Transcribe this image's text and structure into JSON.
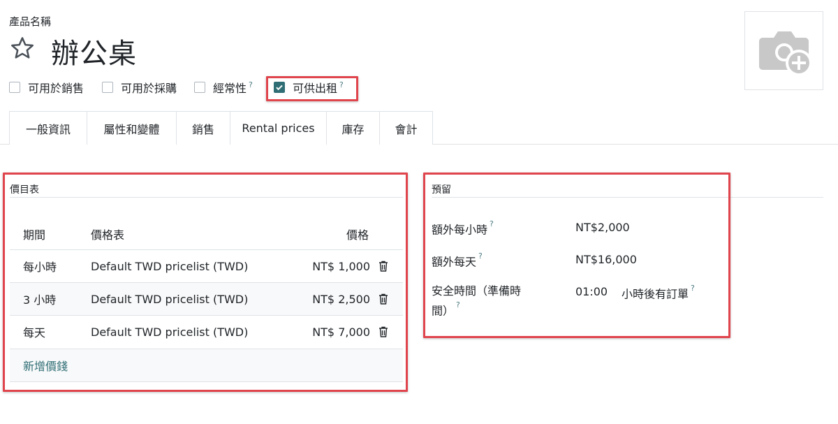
{
  "header": {
    "field_label": "產品名稱",
    "product_name": "辦公桌",
    "checkboxes": [
      {
        "label": "可用於銷售",
        "checked": false
      },
      {
        "label": "可用於採購",
        "checked": false
      },
      {
        "label": "經常性",
        "checked": false,
        "help": "?"
      },
      {
        "label": "可供出租",
        "checked": true,
        "help": "?"
      }
    ]
  },
  "tabs": [
    {
      "label": "一般資訊",
      "active": false
    },
    {
      "label": "屬性和變體",
      "active": false
    },
    {
      "label": "銷售",
      "active": false
    },
    {
      "label": "Rental prices",
      "active": true
    },
    {
      "label": "庫存",
      "active": false
    },
    {
      "label": "會計",
      "active": false
    }
  ],
  "pricing": {
    "title": "價目表",
    "columns": {
      "period": "期間",
      "pricelist": "價格表",
      "price": "價格"
    },
    "rows": [
      {
        "period": "每小時",
        "pricelist": "Default TWD pricelist (TWD)",
        "price": "NT$ 1,000"
      },
      {
        "period": "3 小時",
        "pricelist": "Default TWD pricelist (TWD)",
        "price": "NT$ 2,500"
      },
      {
        "period": "每天",
        "pricelist": "Default TWD pricelist (TWD)",
        "price": "NT$ 7,000"
      }
    ],
    "add_line": "新增價錢"
  },
  "reservations": {
    "title": "預留",
    "extra_hour_label": "額外每小時",
    "extra_hour_value": "NT$2,000",
    "extra_day_label": "額外每天",
    "extra_day_value": "NT$16,000",
    "security_label_line1": "安全時間（準備時",
    "security_label_line2": "間）",
    "security_value": "01:00",
    "security_suffix": "小時後有訂單",
    "help": "?"
  },
  "colors": {
    "accent": "#2f6e75",
    "highlight": "#e0444c",
    "border": "#dee2e6"
  },
  "icons": {
    "favorite": "star-outline-icon",
    "photo": "camera-plus-icon",
    "delete": "trash-icon",
    "checkbox_checked": "check-icon"
  }
}
